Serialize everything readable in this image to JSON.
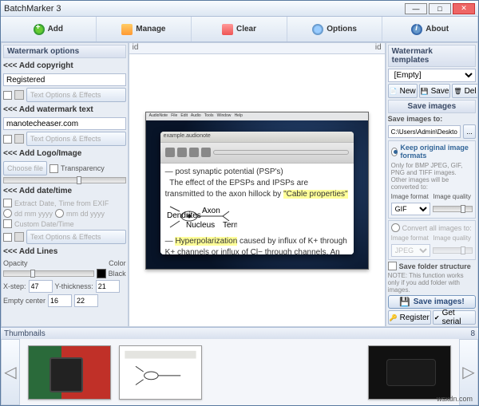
{
  "window": {
    "title": "BatchMarker 3"
  },
  "toolbar": {
    "add": "Add",
    "manage": "Manage",
    "clear": "Clear",
    "options": "Options",
    "about": "About"
  },
  "left": {
    "header": "Watermark options",
    "copyright": {
      "title": "<<< Add copyright",
      "value": "Registered",
      "btn": "Text Options & Effects"
    },
    "text": {
      "title": "<<< Add watermark text",
      "value": "manotecheaser.com",
      "btn": "Text Options & Effects"
    },
    "logo": {
      "title": "<<< Add Logo/Image",
      "choose": "Choose file",
      "transparency": "Transparency"
    },
    "datetime": {
      "title": "<<< Add date/time",
      "extract": "Extract",
      "date": "Date,",
      "timeexif": "Time from EXIF",
      "fmt1": "dd mm yyyy",
      "fmt2": "mm dd yyyy",
      "custom": "Custom Date/Time",
      "btn": "Text Options & Effects"
    },
    "lines": {
      "title": "<<< Add Lines",
      "opacity": "Opacity",
      "color": "Color",
      "black": "Black",
      "xstep": "X-step:",
      "xval": "47",
      "ythick": "Y-thickness:",
      "ytval": "21",
      "emptycenter": "Empty center",
      "ecval": "16",
      "ecval2": "22"
    }
  },
  "center": {
    "ruler_l": "id",
    "ruler_r": "id"
  },
  "right": {
    "header": "Watermark templates",
    "template": "[Empty]",
    "new": "New",
    "save": "Save",
    "del": "Del",
    "saveimg_hdr": "Save images",
    "saveto": "Save images to:",
    "path": "C:\\Users\\Admin\\Desktop\\images",
    "keep": "Keep original image formats",
    "keepnote": "Only for BMP JPEG, GIF, PNG and TIFF images. Other images will be converted to:",
    "imgfmt": "Image format",
    "imgqual": "Image quality",
    "fmt1": "GIF",
    "convert": "Convert all images to:",
    "fmt2": "JPEG",
    "savefolder": "Save folder structure",
    "note": "NOTE: This function works only if you add folder with images.",
    "savebtn": "Save images!",
    "register": "Register",
    "getserial": "Get serial"
  },
  "thumbs": {
    "header": "Thumbnails",
    "count": "8"
  },
  "watermark_site": "wsxdn.com"
}
